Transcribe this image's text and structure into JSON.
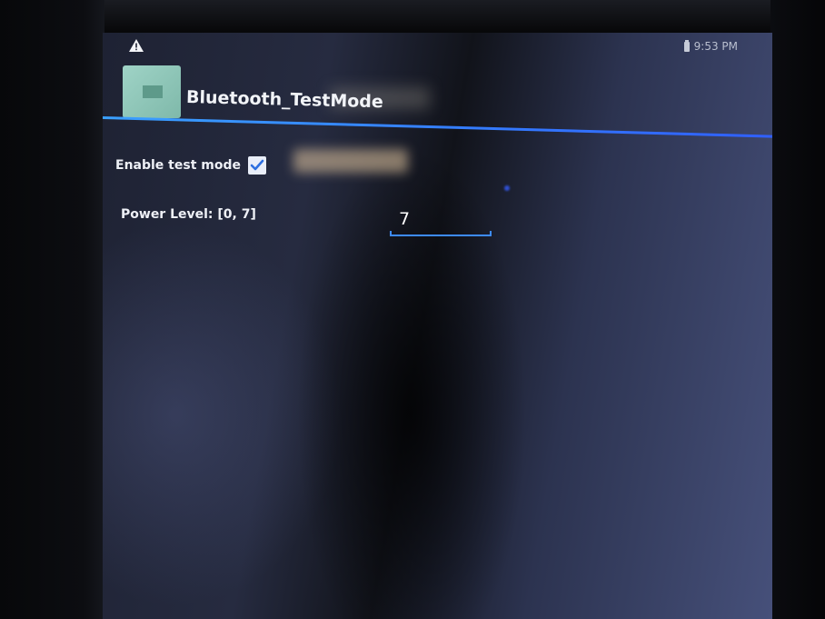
{
  "status_bar": {
    "time": "9:53 PM",
    "warning_icon": "warning-triangle-icon",
    "battery_icon": "battery-icon"
  },
  "app": {
    "title": "Bluetooth_TestMode",
    "icon": "app-icon",
    "accent_color": "#3d8bff"
  },
  "settings": {
    "enable_test_mode_label": "Enable test mode",
    "enable_test_mode_checked": true,
    "power_level_label": "Power Level: [0, 7]",
    "power_level_value": "7"
  }
}
